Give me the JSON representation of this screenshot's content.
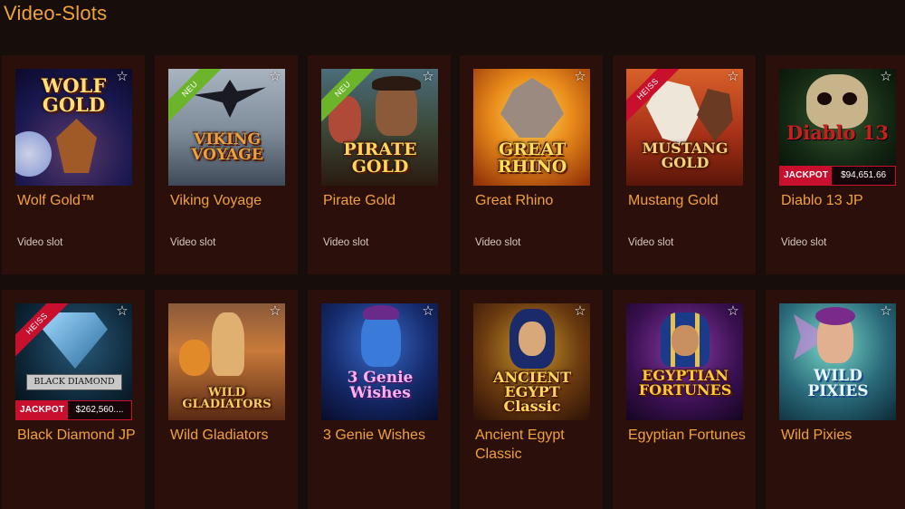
{
  "page": {
    "title": "Video-Slots"
  },
  "games": [
    {
      "title": "Wolf Gold™",
      "type": "Video slot",
      "badge": "",
      "art": "WOLF GOLD",
      "jackpot": ""
    },
    {
      "title": "Viking Voyage",
      "type": "Video slot",
      "badge": "NEU",
      "art": "VIKING VOYAGE",
      "jackpot": ""
    },
    {
      "title": "Pirate Gold",
      "type": "Video slot",
      "badge": "NEU",
      "art": "PIRATE GOLD",
      "jackpot": ""
    },
    {
      "title": "Great Rhino",
      "type": "Video slot",
      "badge": "",
      "art": "GREAT RHINO",
      "jackpot": ""
    },
    {
      "title": "Mustang Gold",
      "type": "Video slot",
      "badge": "HEISS",
      "art": "MUSTANG GOLD",
      "jackpot": ""
    },
    {
      "title": "Diablo 13 JP",
      "type": "Video slot",
      "badge": "",
      "art": "Diablo 13",
      "jackpot": "$94,651.66"
    },
    {
      "title": "Black Diamond JP",
      "type": "",
      "badge": "HEISS",
      "art": "BLACK DIAMOND",
      "jackpot": "$262,560...."
    },
    {
      "title": "Wild Gladiators",
      "type": "",
      "badge": "",
      "art": "WILD GLADIATORS",
      "jackpot": ""
    },
    {
      "title": "3 Genie Wishes",
      "type": "",
      "badge": "",
      "art": "3 Genie Wishes",
      "jackpot": ""
    },
    {
      "title": "Ancient Egypt Classic",
      "type": "",
      "badge": "",
      "art": "ANCIENT EGYPT Classic",
      "jackpot": ""
    },
    {
      "title": "Egyptian Fortunes",
      "type": "",
      "badge": "",
      "art": "EGYPTIAN FORTUNES",
      "jackpot": ""
    },
    {
      "title": "Wild Pixies",
      "type": "",
      "badge": "",
      "art": "WILD PIXIES",
      "jackpot": ""
    }
  ],
  "jackpot_label": "JACKPOT",
  "icons": {
    "favorite": "star-outline-icon"
  },
  "colors": {
    "accent": "#f0a23a",
    "card_bg": "#2b0f0b",
    "page_bg": "#170e0c",
    "badge_new": "#6cb52a",
    "badge_hot": "#c8102e"
  }
}
